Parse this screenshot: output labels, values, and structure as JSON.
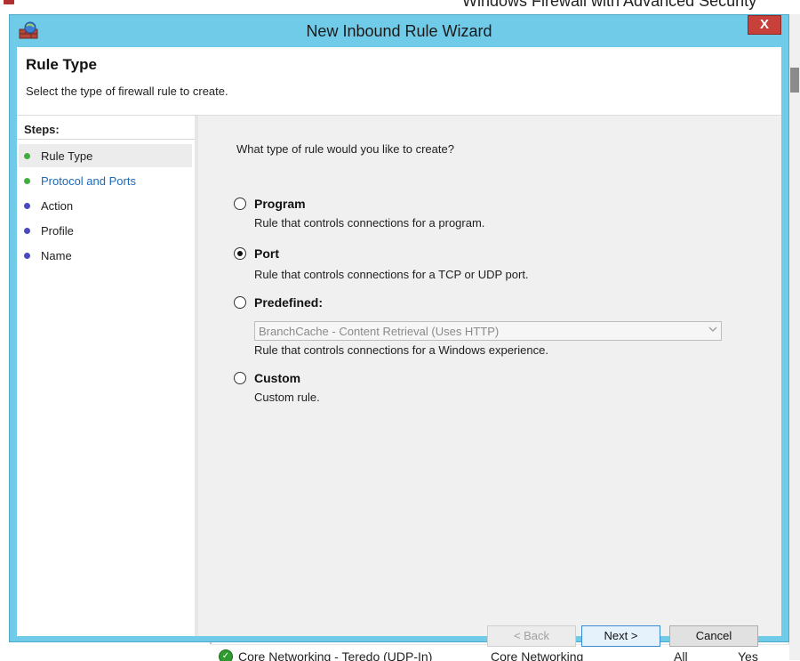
{
  "background_window": {
    "title": "Windows Firewall with Advanced Security",
    "row": {
      "name": "Core Networking - Teredo (UDP-In)",
      "group": "Core Networking",
      "profile": "All",
      "enabled": "Yes"
    }
  },
  "dialog": {
    "title": "New Inbound Rule Wizard",
    "close_label": "X"
  },
  "header": {
    "title": "Rule Type",
    "subtitle": "Select the type of firewall rule to create."
  },
  "steps": {
    "heading": "Steps:",
    "items": [
      {
        "label": "Rule Type",
        "state": "current"
      },
      {
        "label": "Protocol and Ports",
        "state": "next"
      },
      {
        "label": "Action",
        "state": "pending"
      },
      {
        "label": "Profile",
        "state": "pending"
      },
      {
        "label": "Name",
        "state": "pending"
      }
    ]
  },
  "main": {
    "question": "What type of rule would you like to create?",
    "options": [
      {
        "label": "Program",
        "description": "Rule that controls connections for a program.",
        "checked": false
      },
      {
        "label": "Port",
        "description": "Rule that controls connections for a TCP or UDP port.",
        "checked": true
      },
      {
        "label": "Predefined:",
        "description": "Rule that controls connections for a Windows experience.",
        "checked": false
      },
      {
        "label": "Custom",
        "description": "Custom rule.",
        "checked": false
      }
    ],
    "predefined_select": {
      "value": "BranchCache - Content Retrieval (Uses HTTP)",
      "enabled": false
    }
  },
  "buttons": {
    "back": "< Back",
    "next": "Next >",
    "cancel": "Cancel"
  },
  "colors": {
    "titlebar": "#6fcbe8",
    "close": "#c7413a",
    "step_done": "#3fae3f",
    "step_pending": "#4a4ac0",
    "link_blue": "#1c6ab8"
  }
}
